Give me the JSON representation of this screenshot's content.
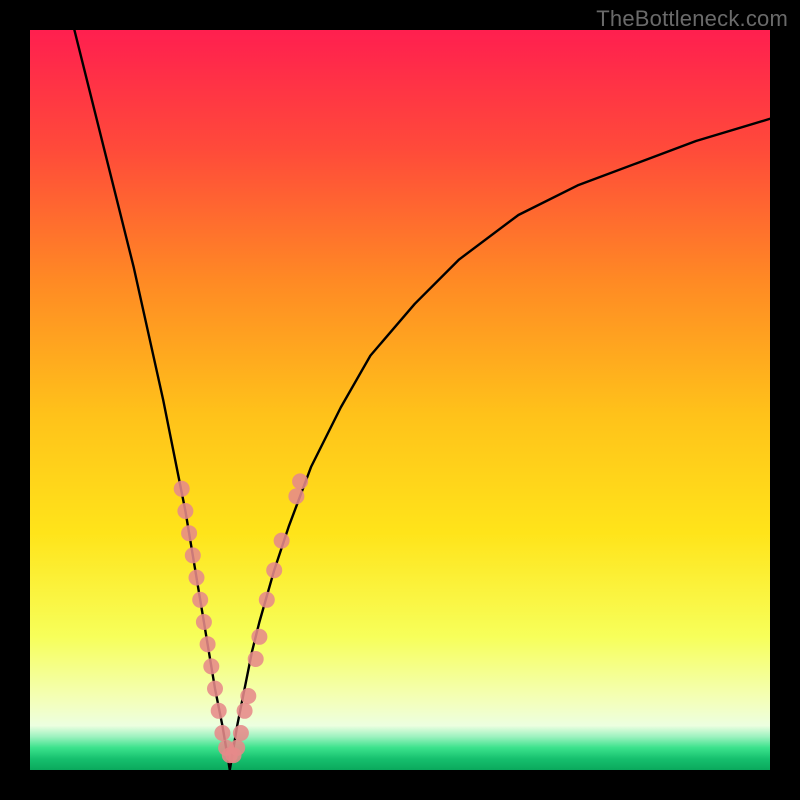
{
  "watermark": "TheBottleneck.com",
  "chart_data": {
    "type": "line",
    "title": "",
    "xlabel": "",
    "ylabel": "",
    "xlim": [
      0,
      100
    ],
    "ylim": [
      0,
      100
    ],
    "grid": false,
    "legend": false,
    "series": [
      {
        "name": "curve-left",
        "x": [
          6,
          8,
          10,
          12,
          14,
          16,
          18,
          19,
          20,
          21,
          22,
          23,
          24,
          25,
          26,
          27
        ],
        "values": [
          100,
          92,
          84,
          76,
          68,
          59,
          50,
          45,
          40,
          35,
          29,
          23,
          17,
          11,
          6,
          0
        ]
      },
      {
        "name": "curve-right",
        "x": [
          27,
          28,
          29,
          30,
          31,
          33,
          35,
          38,
          42,
          46,
          52,
          58,
          66,
          74,
          82,
          90,
          100
        ],
        "values": [
          0,
          6,
          11,
          16,
          20,
          27,
          33,
          41,
          49,
          56,
          63,
          69,
          75,
          79,
          82,
          85,
          88
        ]
      }
    ],
    "scatter_points": {
      "name": "highlighted-points",
      "color": "#e68a8a",
      "points": [
        {
          "x": 20.5,
          "y": 38
        },
        {
          "x": 21.0,
          "y": 35
        },
        {
          "x": 21.5,
          "y": 32
        },
        {
          "x": 22.0,
          "y": 29
        },
        {
          "x": 22.5,
          "y": 26
        },
        {
          "x": 23.0,
          "y": 23
        },
        {
          "x": 23.5,
          "y": 20
        },
        {
          "x": 24.0,
          "y": 17
        },
        {
          "x": 24.5,
          "y": 14
        },
        {
          "x": 25.0,
          "y": 11
        },
        {
          "x": 25.5,
          "y": 8
        },
        {
          "x": 26.0,
          "y": 5
        },
        {
          "x": 26.5,
          "y": 3
        },
        {
          "x": 27.0,
          "y": 2
        },
        {
          "x": 27.5,
          "y": 2
        },
        {
          "x": 28.0,
          "y": 3
        },
        {
          "x": 28.5,
          "y": 5
        },
        {
          "x": 29.0,
          "y": 8
        },
        {
          "x": 29.5,
          "y": 10
        },
        {
          "x": 30.5,
          "y": 15
        },
        {
          "x": 31.0,
          "y": 18
        },
        {
          "x": 32.0,
          "y": 23
        },
        {
          "x": 33.0,
          "y": 27
        },
        {
          "x": 34.0,
          "y": 31
        },
        {
          "x": 36.0,
          "y": 37
        },
        {
          "x": 36.5,
          "y": 39
        }
      ]
    },
    "background_gradient": {
      "top_color": "#ff1f4f",
      "mid_colors": [
        "#ff6a2d",
        "#ffb11a",
        "#ffe41a",
        "#f7ff5a"
      ],
      "bottom_pale": "#f2ffd4",
      "bottom_green": "#18e07e",
      "bottom_dark": "#0aa85c"
    }
  }
}
